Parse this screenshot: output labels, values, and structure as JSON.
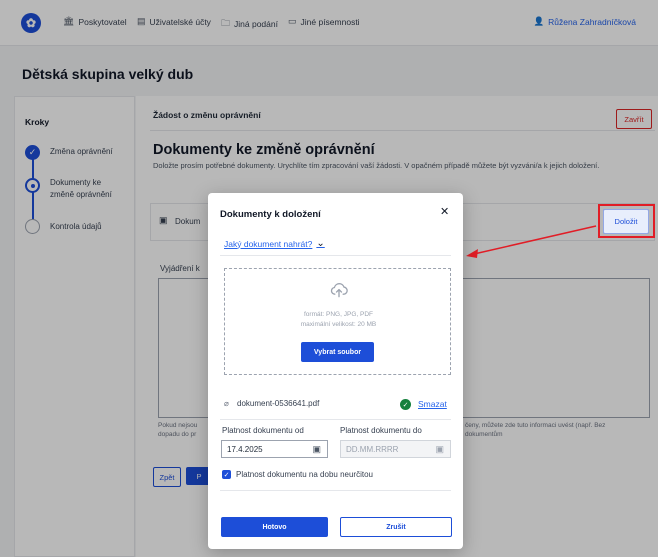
{
  "topbar": {
    "nav": [
      {
        "label": "Poskytovatel",
        "icon": "building-icon"
      },
      {
        "label": "Uživatelské účty",
        "icon": "accounts-icon"
      },
      {
        "label": "Jiná podání",
        "icon": "documents-icon"
      },
      {
        "label": "Jiné písemnosti",
        "icon": "book-icon"
      }
    ],
    "user": "Růžena Zahradníčková"
  },
  "page": {
    "title": "Dětská skupina velký dub"
  },
  "sidebar": {
    "heading": "Kroky",
    "steps": [
      {
        "label": "Změna oprávnění",
        "state": "done"
      },
      {
        "label": "Dokumenty ke",
        "label2": "změně oprávnění",
        "state": "active"
      },
      {
        "label": "Kontrola údajů",
        "state": "todo"
      }
    ]
  },
  "main": {
    "request_title": "Žádost o změnu oprávnění",
    "close_label": "Zavřít",
    "heading": "Dokumenty ke změně oprávnění",
    "description": "Doložte prosím potřebné dokumenty. Urychlíte tím zpracování vaší žádosti. V opačném případě můžete být vyzváni/a k jejich doložení.",
    "doc_row_label": "Dokum",
    "upload_label": "Doložit",
    "statement_label": "Vyjádření k",
    "hint": "Pokud nejsou ... dopadu do pr ... čeny, můžete zde tuto informaci uvést (např. Bez ... dokumentům",
    "hint_left": "Pokud nejsou",
    "hint_left2": "dopadu do pr",
    "hint_right": "čeny, můžete zde tuto informaci uvést (např. Bez",
    "hint_right2": "dokumentům",
    "back_label": "Zpět",
    "next_label": "P"
  },
  "modal": {
    "title": "Dokumenty k doložení",
    "which_doc_link": "Jaký dokument nahrát?",
    "format_text": "formát: PNG, JPG, PDF",
    "max_size_text": "maximální velikost: 20 MB",
    "choose_file_label": "Vybrat soubor",
    "file_name": "dokument-0536641.pdf",
    "delete_label": "Smazat",
    "valid_from_label": "Platnost dokumentu od",
    "valid_from_value": "17.4.2025",
    "valid_to_label": "Platnost dokumentu do",
    "valid_to_placeholder": "DD.MM.RRRR",
    "indefinite_label": "Platnost dokumentu na dobu neurčitou",
    "indefinite_checked": true,
    "done_label": "Hotovo",
    "cancel_label": "Zrušit"
  },
  "colors": {
    "primary": "#1d4ed8",
    "danger": "#dc2626",
    "annotation": "#e11d26",
    "success": "#15803d"
  }
}
